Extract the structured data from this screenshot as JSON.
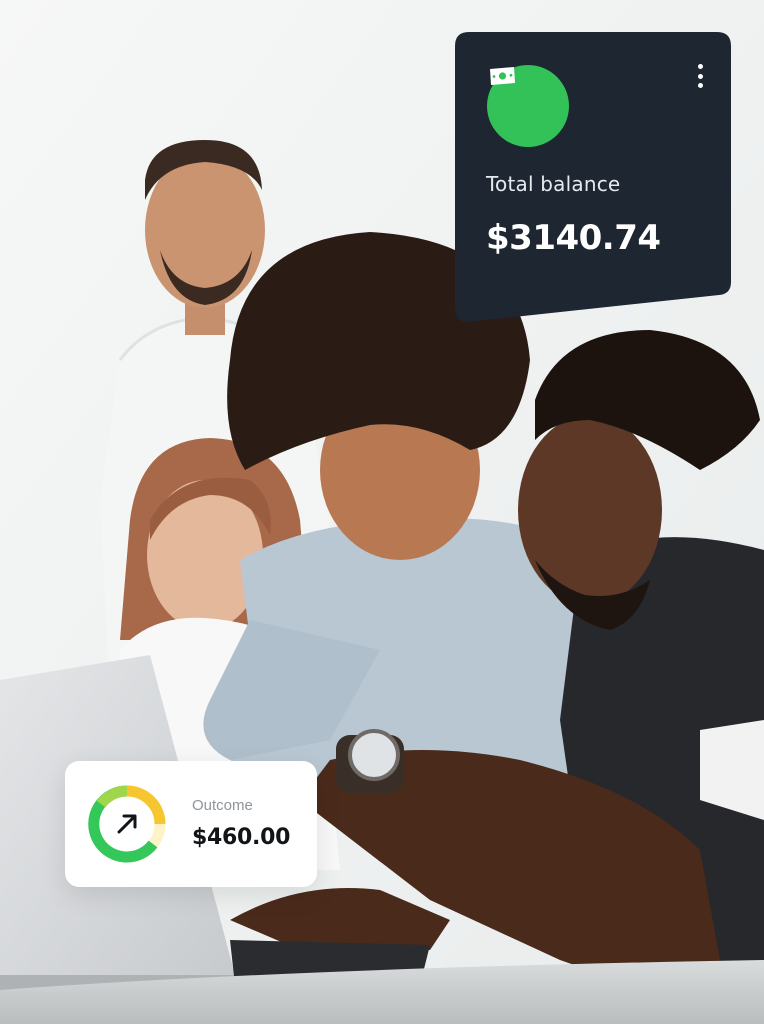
{
  "balance_card": {
    "label": "Total balance",
    "amount": "$3140.74",
    "icon": "money-icon",
    "menu_icon": "more-vertical-icon",
    "background_color": "#1e2631",
    "icon_bg_color": "#32c257"
  },
  "outcome_card": {
    "label": "Outcome",
    "amount": "$460.00",
    "icon": "arrow-up-right-icon",
    "progress_fraction": 0.75,
    "ring_colors": [
      "#34c759",
      "#f6c631",
      "#fdf3c6"
    ]
  },
  "photo": {
    "icon": "team-at-laptop-photo"
  }
}
